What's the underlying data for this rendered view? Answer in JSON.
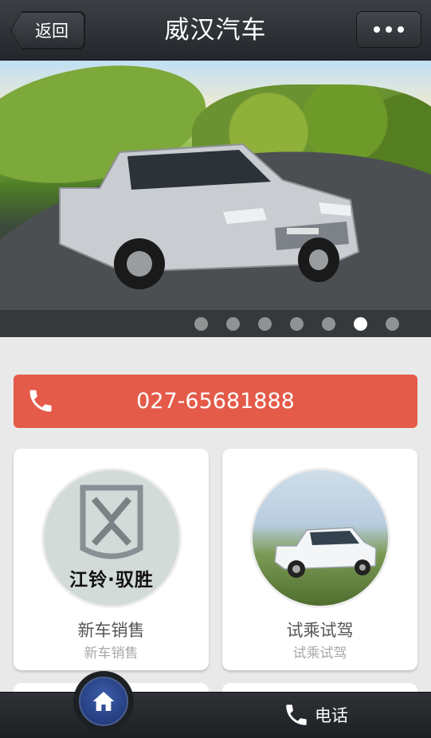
{
  "header": {
    "back_label": "返回",
    "title": "威汉汽车"
  },
  "banner": {
    "slide_count": 7,
    "active_slide": 6
  },
  "phone_bar": {
    "number": "027-65681888",
    "icon": "phone-icon"
  },
  "cards": [
    {
      "title": "新车销售",
      "subtitle": "新车销售",
      "logo_text": "江铃·驭胜"
    },
    {
      "title": "试乘试驾",
      "subtitle": "试乘试驾"
    }
  ],
  "bottom_bar": {
    "home_icon": "home-icon",
    "call_label": "电话",
    "call_icon": "phone-icon"
  },
  "colors": {
    "header_bg": "#2b2f33",
    "phone_bar_bg": "#e45b4a",
    "page_bg": "#e9e9e9",
    "home_btn_bg": "#2a4288"
  }
}
